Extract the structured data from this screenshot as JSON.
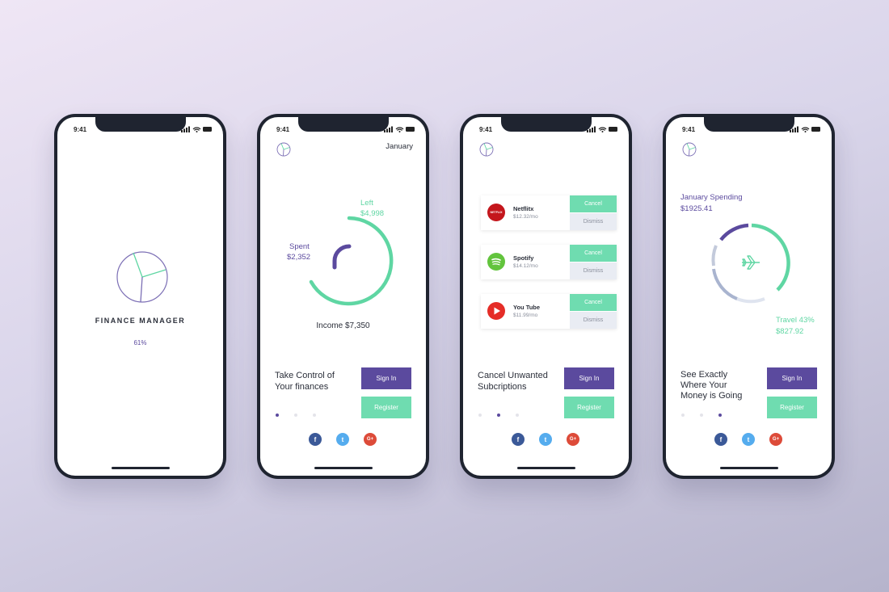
{
  "status": {
    "time": "9:41"
  },
  "screen1": {
    "title": "FINANCE MANAGER",
    "progress": "61%"
  },
  "screen2": {
    "month": "January",
    "left_label": "Left",
    "left_value": "$4,998",
    "spent_label": "Spent",
    "spent_value": "$2,352",
    "income": "Income $7,350",
    "headline_line1": "Take Control of",
    "headline_line2": "Your finances",
    "sign_in": "Sign In",
    "register": "Register"
  },
  "screen3": {
    "subscriptions": [
      {
        "name": "Netflitx",
        "price": "$12.32/mo",
        "icon": "netflix-icon",
        "color": "#c4161c",
        "badge": "NETFLIX"
      },
      {
        "name": "Spotify",
        "price": "$14.12/mo",
        "icon": "spotify-icon",
        "color": "#62c43d",
        "badge": ""
      },
      {
        "name": "You Tube",
        "price": "$11.99/mo",
        "icon": "youtube-icon",
        "color": "#e52d27",
        "badge": ""
      }
    ],
    "cancel_label": "Cancel",
    "dismiss_label": "Dismiss",
    "headline_line1": "Cancel Unwanted",
    "headline_line2": "Subcriptions",
    "sign_in": "Sign In",
    "register": "Register"
  },
  "screen4": {
    "spending_label": "January Spending",
    "spending_value": "$1925.41",
    "travel_label": "Travel 43%",
    "travel_value": "$827.92",
    "headline_line1": "See Exactly",
    "headline_line2": "Where Your",
    "headline_line3": "Money is Going",
    "sign_in": "Sign In",
    "register": "Register"
  },
  "social": {
    "facebook": "f",
    "twitter": "t",
    "google": "G+"
  },
  "colors": {
    "accent_green": "#5fd6a3",
    "accent_purple": "#5b4a9e",
    "frame": "#1f2430"
  }
}
